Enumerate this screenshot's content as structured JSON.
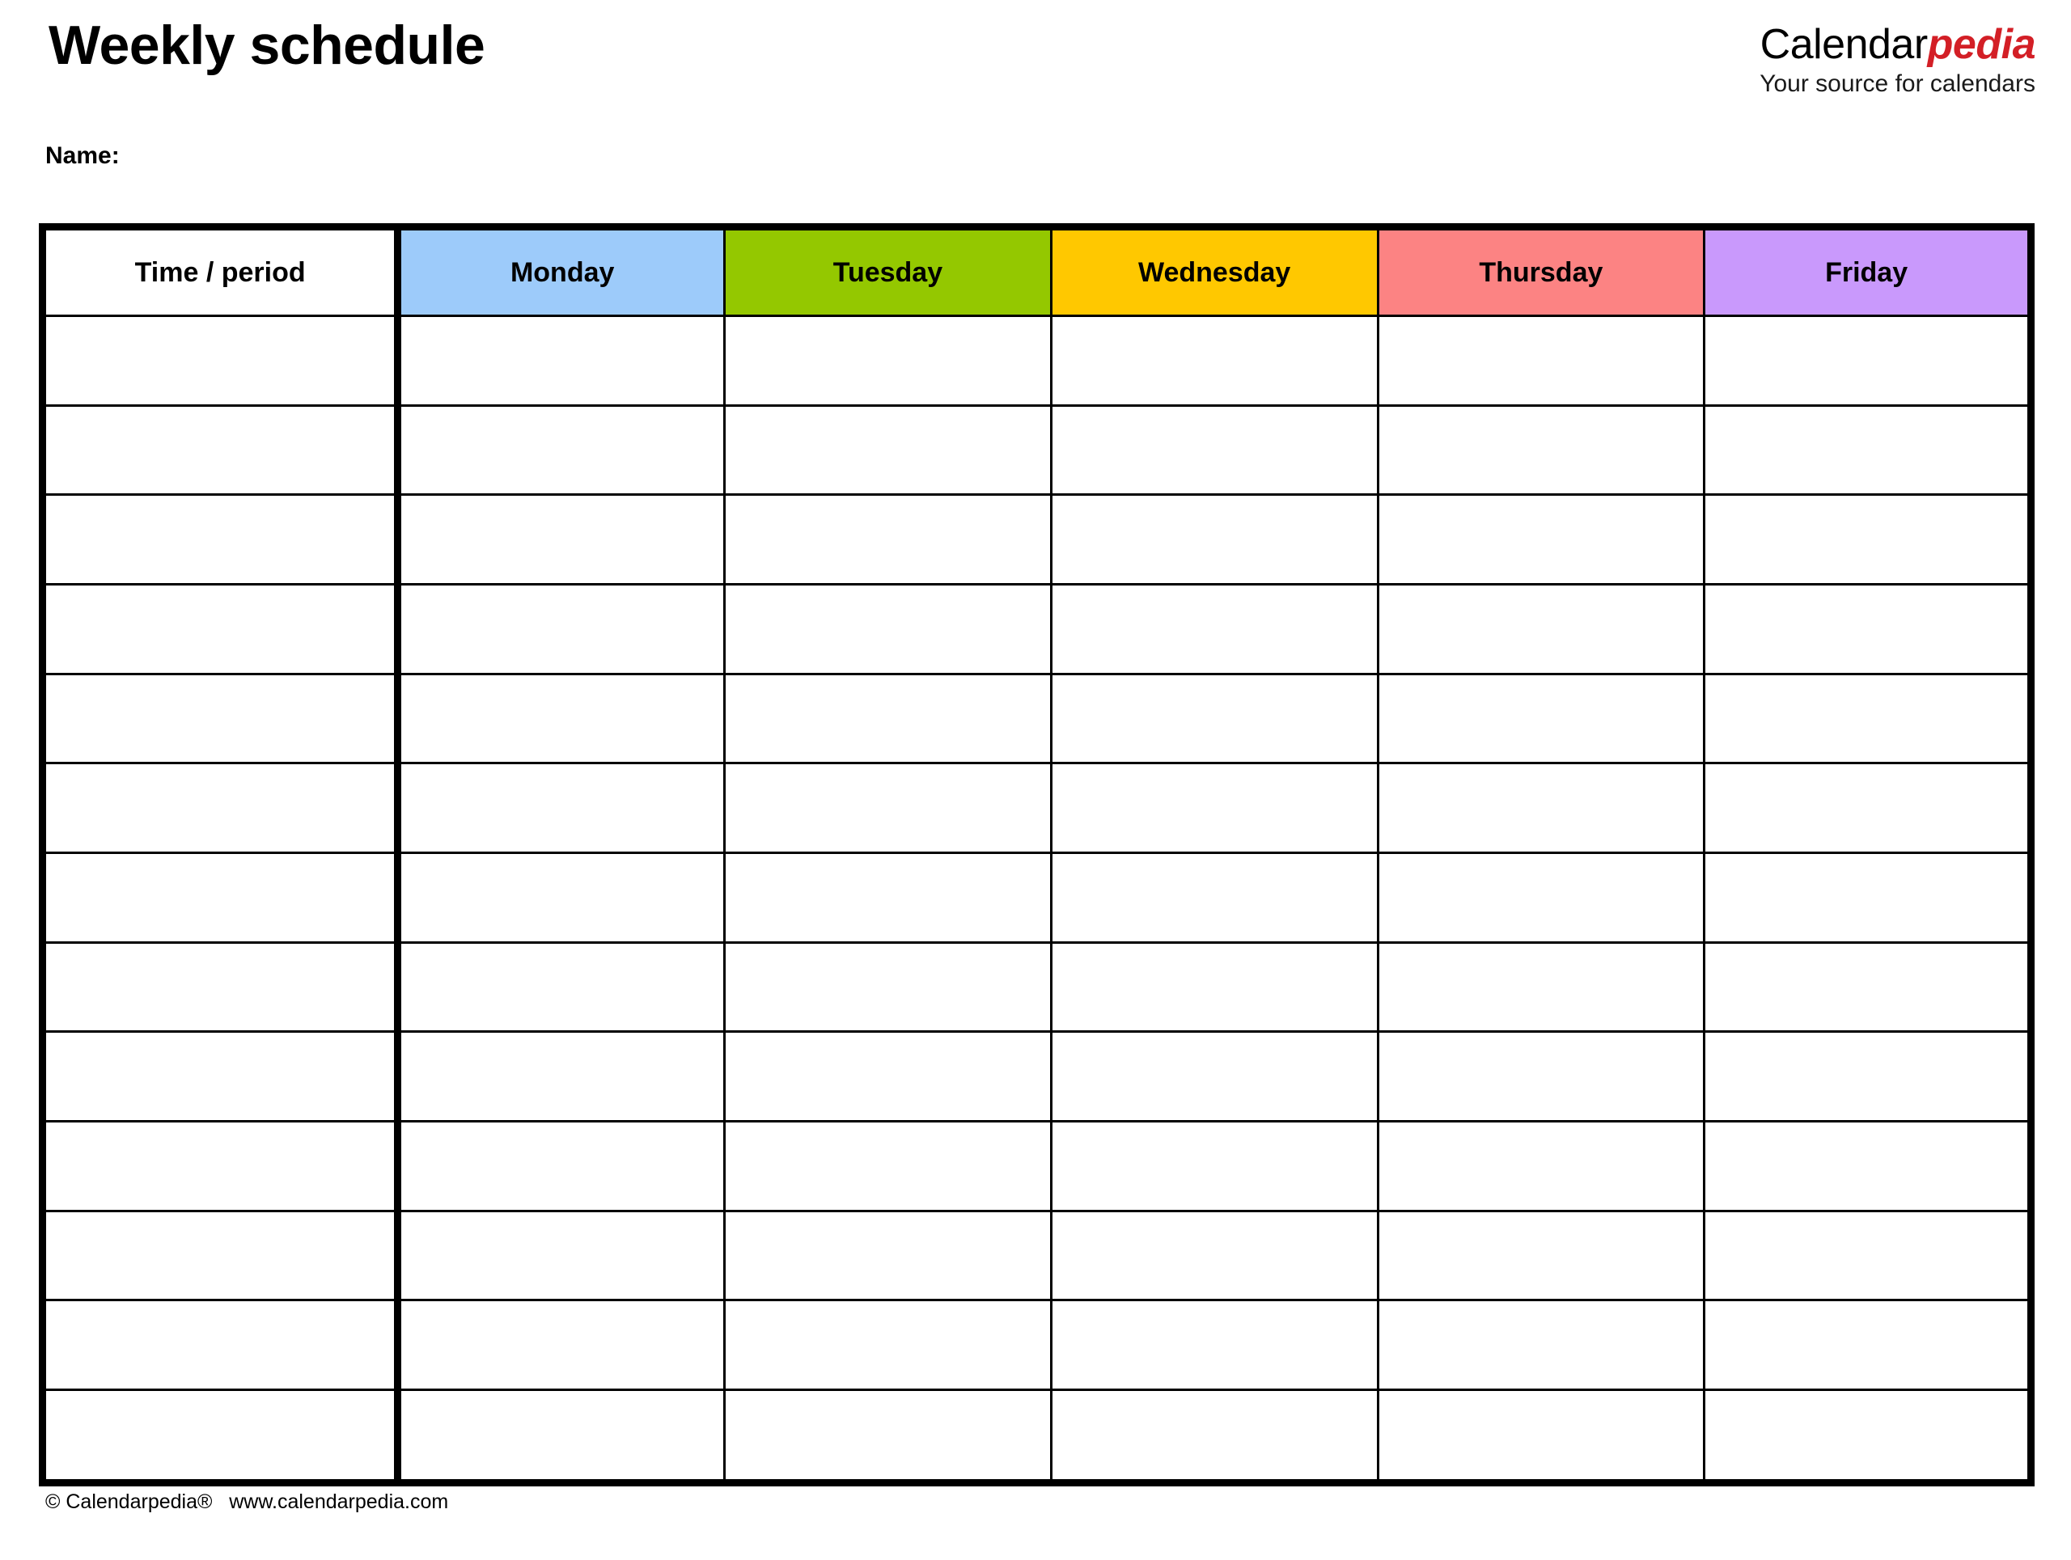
{
  "document": {
    "title": "Weekly schedule",
    "name_label": "Name:"
  },
  "brand": {
    "part_1": "Calendar",
    "part_2": "pedia",
    "tagline": "Your source for calendars",
    "accent_color": "#d31f26"
  },
  "table": {
    "columns": [
      {
        "label": "Time / period",
        "bg": "#ffffff"
      },
      {
        "label": "Monday",
        "bg": "#9dcbfa"
      },
      {
        "label": "Tuesday",
        "bg": "#94c800"
      },
      {
        "label": "Wednesday",
        "bg": "#ffc800"
      },
      {
        "label": "Thursday",
        "bg": "#fc8383"
      },
      {
        "label": "Friday",
        "bg": "#c999fc"
      }
    ],
    "row_count": 13,
    "rows": [
      [
        "",
        "",
        "",
        "",
        "",
        ""
      ],
      [
        "",
        "",
        "",
        "",
        "",
        ""
      ],
      [
        "",
        "",
        "",
        "",
        "",
        ""
      ],
      [
        "",
        "",
        "",
        "",
        "",
        ""
      ],
      [
        "",
        "",
        "",
        "",
        "",
        ""
      ],
      [
        "",
        "",
        "",
        "",
        "",
        ""
      ],
      [
        "",
        "",
        "",
        "",
        "",
        ""
      ],
      [
        "",
        "",
        "",
        "",
        "",
        ""
      ],
      [
        "",
        "",
        "",
        "",
        "",
        ""
      ],
      [
        "",
        "",
        "",
        "",
        "",
        ""
      ],
      [
        "",
        "",
        "",
        "",
        "",
        ""
      ],
      [
        "",
        "",
        "",
        "",
        "",
        ""
      ],
      [
        "",
        "",
        "",
        "",
        "",
        ""
      ]
    ]
  },
  "footer": {
    "copyright": "© Calendarpedia®",
    "website": "www.calendarpedia.com",
    "text": "© Calendarpedia®   www.calendarpedia.com"
  }
}
